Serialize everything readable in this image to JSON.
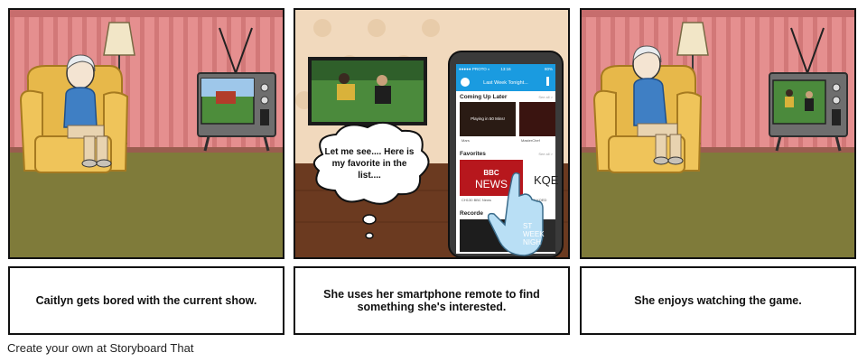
{
  "panels": [
    {
      "caption": "Caitlyn gets bored with the current show."
    },
    {
      "caption": "She uses her smartphone remote to find something she's interested."
    },
    {
      "caption": "She enjoys watching the game."
    }
  ],
  "bubble": {
    "lines": [
      "Let me see.... Here is",
      "my favorite in the",
      "list...."
    ]
  },
  "phone": {
    "status_carrier": "●●●●● PROTO ◐",
    "status_time": "13:16",
    "status_battery": "80%",
    "now_playing": "Last Week Tonight...",
    "coming_up_label": "Coming Up Later",
    "see_all": "See all >",
    "tile1_label": "Playing in 50 Mins!",
    "tile1_caption": "Mars",
    "tile2_caption": "MasterChef",
    "favorites_label": "Favorites",
    "bbc_text": "BBC",
    "news_text": "NEWS",
    "fav1_caption": "CH130 BBC News",
    "kqed_text": "KQE",
    "fav2_caption": "CH9 KQED",
    "recordings_label": "Recorde",
    "rec_text": "ST\nWEEK\nNIGH"
  },
  "footer": "Create your own at Storyboard That",
  "colors": {
    "wallpaper_pink": "#e58f8f",
    "wallpaper_stripe": "#d67b7b",
    "floor_olive": "#7f7b3a",
    "chair_yellow": "#e7b84a",
    "tv_gray": "#6e6e6e",
    "shirt_blue": "#3f7fc4",
    "wall_cream": "#f1d9bd",
    "floor_wood": "#6b3a20",
    "phone_blue": "#1a9be0"
  }
}
